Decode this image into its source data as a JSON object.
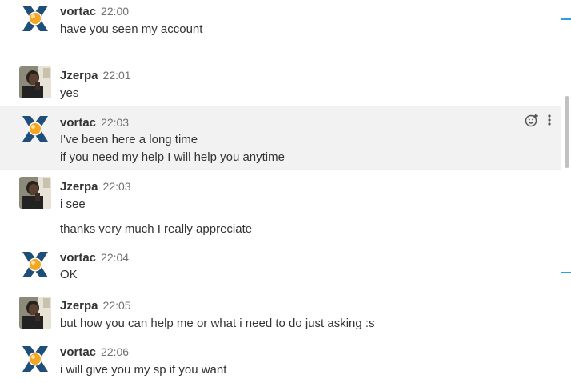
{
  "channel": {
    "messages": [
      {
        "user": "vortac",
        "time": "22:00",
        "lines": [
          "have you seen my account"
        ]
      },
      {
        "user": "Jzerpa",
        "time": "22:01",
        "lines": [
          "yes"
        ]
      },
      {
        "user": "vortac",
        "time": "22:03",
        "lines": [
          "I've been here a long time",
          "if you need my help I will help you anytime"
        ]
      },
      {
        "user": "Jzerpa",
        "time": "22:03",
        "lines": [
          "i see",
          "thanks very much I really appreciate"
        ]
      },
      {
        "user": "vortac",
        "time": "22:04",
        "lines": [
          "OK"
        ]
      },
      {
        "user": "Jzerpa",
        "time": "22:05",
        "lines": [
          "but how you can help me or what i need to do just asking :s"
        ]
      },
      {
        "user": "vortac",
        "time": "22:06",
        "lines": [
          "i will give you my sp if you want"
        ]
      }
    ]
  },
  "message_actions": {
    "icons": [
      "add-reaction-icon",
      "more-options-icon"
    ]
  },
  "colors": {
    "hover_background": "#f2f2f2",
    "username": "#333333",
    "timestamp": "#717274",
    "unread_marker": "#2d9ee0",
    "vortac_logo_blue": "#1f4e79",
    "vortac_logo_orange": "#f5a623"
  }
}
